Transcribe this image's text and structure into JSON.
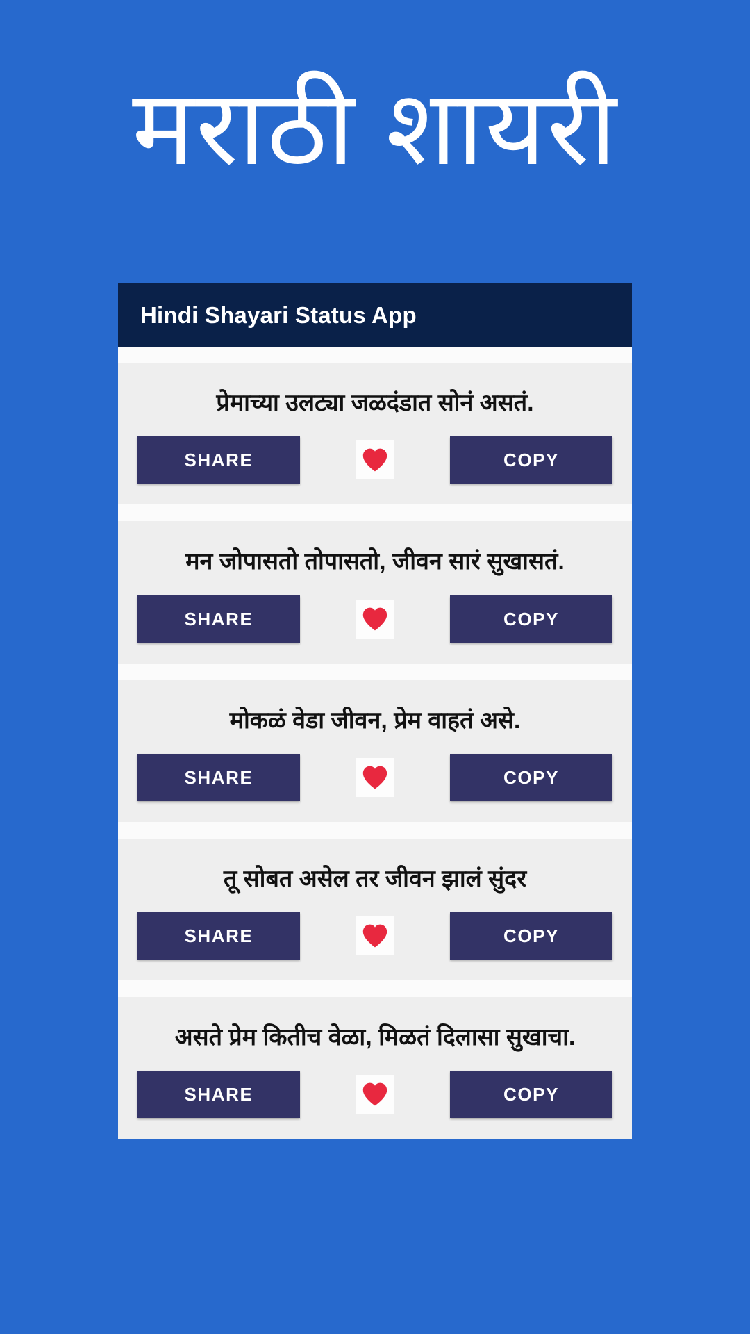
{
  "hero": {
    "title": "मराठी शायरी",
    "background_color": "#2769cd",
    "text_color": "#ffffff"
  },
  "app": {
    "bar": {
      "title": "Hindi Shayari Status App",
      "background_color": "#0a2149",
      "text_color": "#ffffff"
    },
    "card_background_color": "#eeeeee",
    "button_color": "#333366",
    "heart_color": "#e8283f",
    "actions": {
      "share_label": "SHARE",
      "copy_label": "COPY",
      "favorite_icon": "heart-icon"
    },
    "items": [
      {
        "text": "प्रेमाच्या उलट्या जळदंडात सोनं असतं."
      },
      {
        "text": "मन जोपासतो तोपासतो, जीवन सारं सुखासतं."
      },
      {
        "text": "मोकळं वेडा जीवन, प्रेम वाहतं असे."
      },
      {
        "text": "तू सोबत असेल तर जीवन झालं सुंदर"
      },
      {
        "text": "असते प्रेम कितीच वेळा, मिळतं दिलासा सुखाचा."
      }
    ]
  }
}
